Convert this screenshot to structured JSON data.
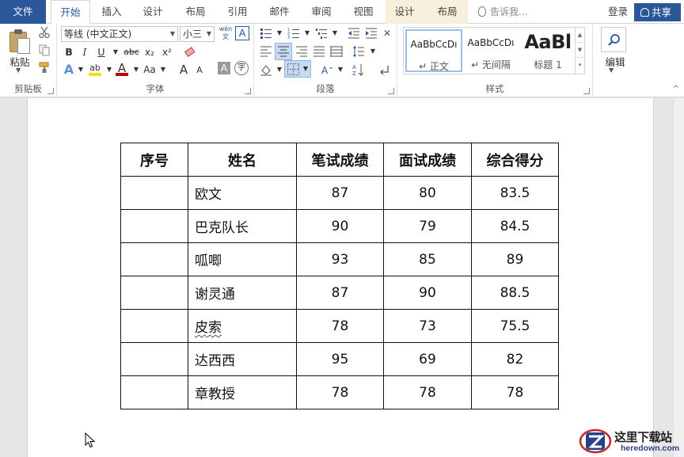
{
  "tabs": {
    "file": "文件",
    "home": "开始",
    "insert": "插入",
    "design": "设计",
    "layout": "布局",
    "references": "引用",
    "mailings": "邮件",
    "review": "审阅",
    "view": "视图",
    "table_design": "设计",
    "table_layout": "布局"
  },
  "tell_me": "告诉我...",
  "login": "登录",
  "share": "共享",
  "ribbon": {
    "clipboard": {
      "paste": "粘贴",
      "label": "剪贴板"
    },
    "font": {
      "font_name": "等线 (中文正文)",
      "font_size": "小三",
      "phonetic": "wén",
      "label": "字体",
      "bold": "B",
      "italic": "I",
      "underline": "U",
      "strike": "abc",
      "subscript": "x₂",
      "superscript": "x²",
      "change_case": "Aa",
      "grow": "A",
      "shrink": "A",
      "shade": "A",
      "enclose": "字"
    },
    "paragraph": {
      "label": "段落"
    },
    "styles": {
      "label": "样式",
      "items": [
        {
          "sample": "AaBbCcDı",
          "name": "↵ 正文"
        },
        {
          "sample": "AaBbCcDı",
          "name": "↵ 无间隔"
        },
        {
          "sample": "AaBl",
          "name": "标题 1"
        }
      ]
    },
    "editing": {
      "label": "编辑"
    }
  },
  "table": {
    "headers": [
      "序号",
      "姓名",
      "笔试成绩",
      "面试成绩",
      "综合得分"
    ],
    "rows": [
      [
        "",
        "欧文",
        "87",
        "80",
        "83.5"
      ],
      [
        "",
        "巴克队长",
        "90",
        "79",
        "84.5"
      ],
      [
        "",
        "呱唧",
        "93",
        "85",
        "89"
      ],
      [
        "",
        "谢灵通",
        "87",
        "90",
        "88.5"
      ],
      [
        "",
        "皮索",
        "78",
        "73",
        "75.5"
      ],
      [
        "",
        "达西西",
        "95",
        "69",
        "82"
      ],
      [
        "",
        "章教授",
        "78",
        "78",
        "78"
      ]
    ]
  },
  "watermark": {
    "title": "这里下载站",
    "url": "heredown.com"
  },
  "colors": {
    "accent": "#2b579a",
    "context_tab": "#f7f0dc",
    "highlight": "#f3e000",
    "font_color": "#c00000"
  }
}
